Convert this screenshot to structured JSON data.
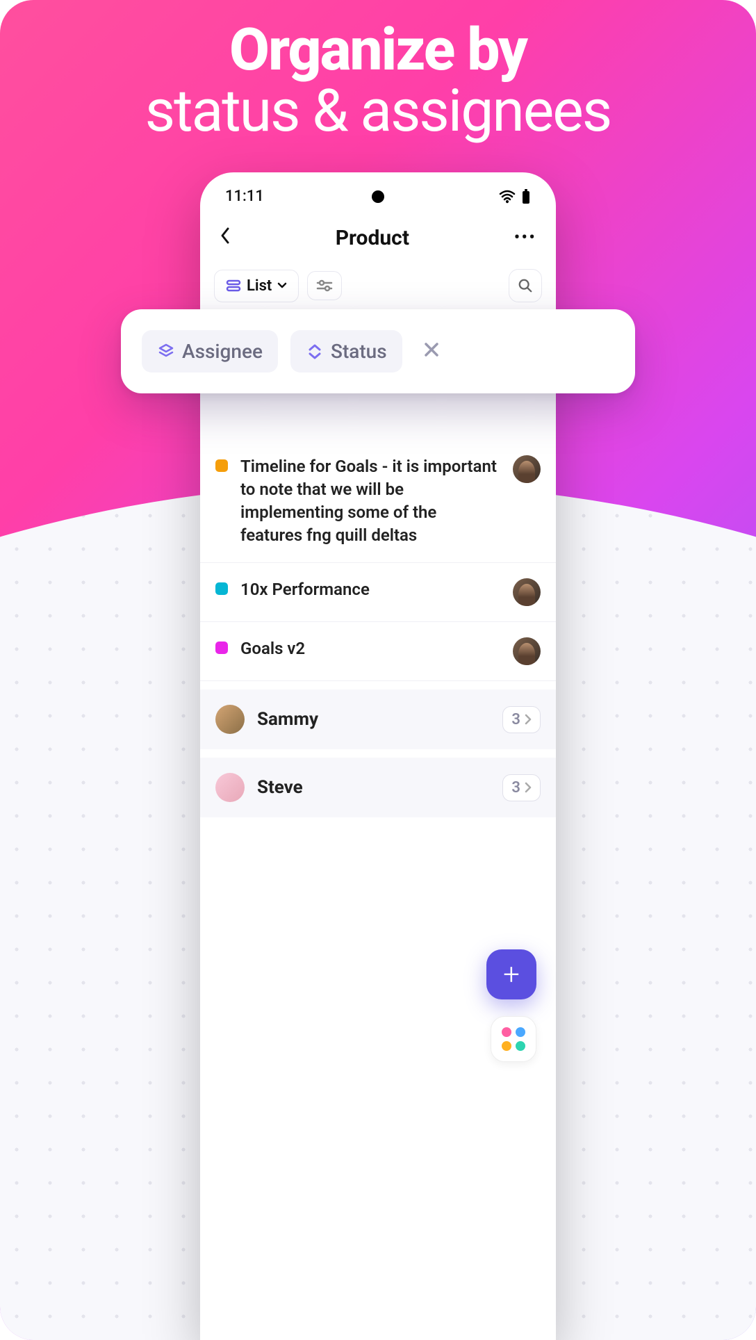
{
  "hero": {
    "line1": "Organize by",
    "line2": "status & assignees"
  },
  "statusbar": {
    "time": "11:11"
  },
  "nav": {
    "title": "Product"
  },
  "toolbar": {
    "view_label": "List"
  },
  "chips": {
    "assignee": "Assignee",
    "status": "Status"
  },
  "tasks": [
    {
      "color": "#f59e0b",
      "title": "Timeline for Goals - it is important to note that we will be implementing some of the features fng quill deltas"
    },
    {
      "color": "#06b6d4",
      "title": "10x Performance"
    },
    {
      "color": "#e926e9",
      "title": "Goals v2"
    }
  ],
  "groups": [
    {
      "name": "Sammy",
      "count": "3",
      "avatar_bg": "linear-gradient(135deg,#d4a574,#8b6f47)"
    },
    {
      "name": "Steve",
      "count": "3",
      "avatar_bg": "linear-gradient(135deg,#f8c8d8,#e8a8b8)"
    }
  ]
}
